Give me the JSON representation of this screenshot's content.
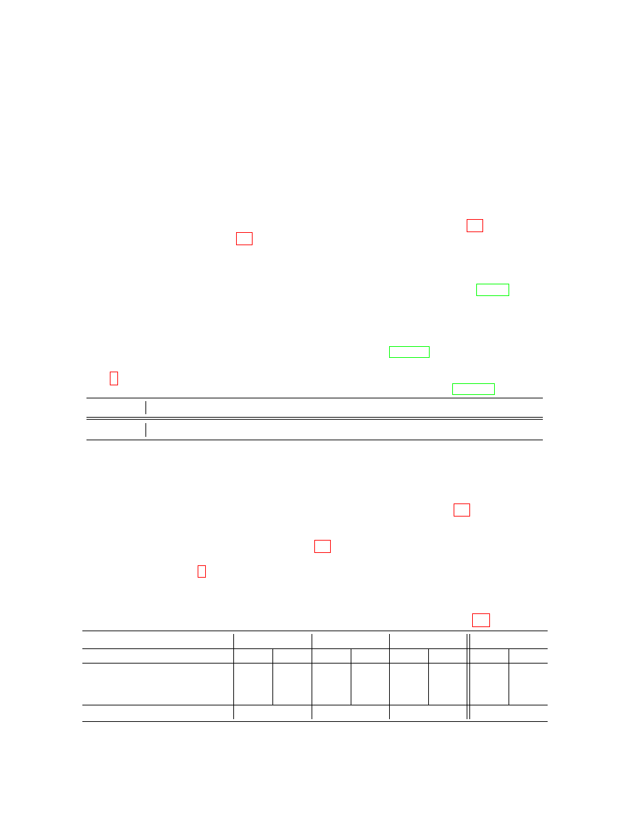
{
  "page": {
    "background": "#ffffff",
    "link_colors": {
      "citation": "#ff0000",
      "url": "#00ff00"
    }
  },
  "citation_links": [
    {
      "id": "cite-1",
      "kind": "citation",
      "text": ""
    },
    {
      "id": "cite-2",
      "kind": "citation",
      "text": ""
    },
    {
      "id": "cite-3",
      "kind": "citation",
      "text": ""
    },
    {
      "id": "cite-4",
      "kind": "citation",
      "text": ""
    },
    {
      "id": "cite-5",
      "kind": "citation",
      "text": ""
    },
    {
      "id": "cite-6",
      "kind": "citation",
      "text": ""
    },
    {
      "id": "cite-7",
      "kind": "citation",
      "text": ""
    }
  ],
  "url_links": [
    {
      "id": "url-1",
      "kind": "url",
      "text": ""
    },
    {
      "id": "url-2",
      "kind": "url",
      "text": ""
    },
    {
      "id": "url-3",
      "kind": "url",
      "text": ""
    }
  ],
  "table_1": {
    "rows": [
      {
        "label": "",
        "value": ""
      },
      {
        "label": "",
        "value": ""
      }
    ]
  },
  "table_2": {
    "header_groups": [
      "",
      "",
      "",
      ""
    ],
    "sub_headers": [
      "",
      "",
      "",
      "",
      "",
      "",
      "",
      ""
    ],
    "body_rows": [
      {
        "label": "",
        "cells": [
          "",
          "",
          "",
          "",
          "",
          "",
          "",
          ""
        ]
      },
      {
        "label": "",
        "cells": [
          "",
          "",
          "",
          ""
        ]
      }
    ]
  }
}
